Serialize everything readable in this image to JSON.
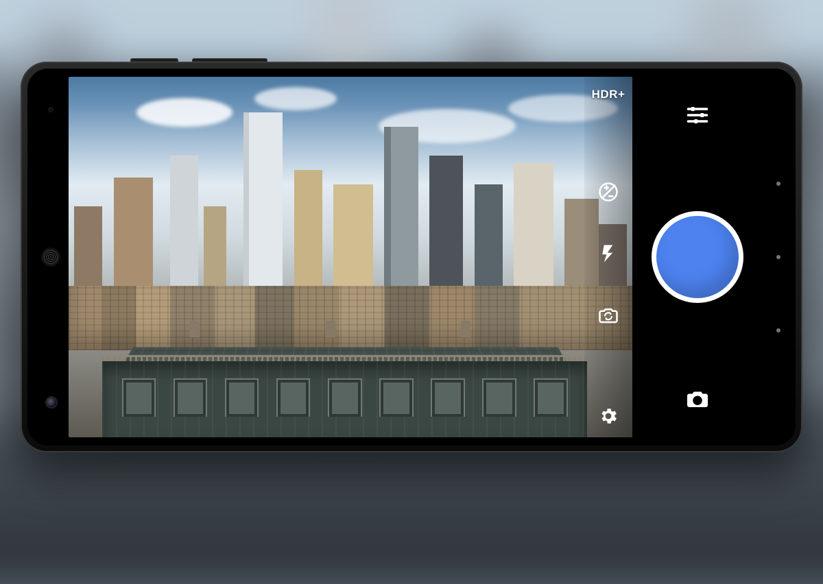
{
  "overlay_toggles": {
    "hdr_label": "HDR+",
    "exposure_icon": "exposure-icon",
    "flash_icon": "flash-icon",
    "switch_camera_icon": "switch-camera-icon",
    "settings_icon": "settings-icon"
  },
  "control_panel": {
    "sliders_icon": "sliders-icon",
    "shutter_color": "#4d82ef",
    "mode_icon": "camera-icon"
  }
}
